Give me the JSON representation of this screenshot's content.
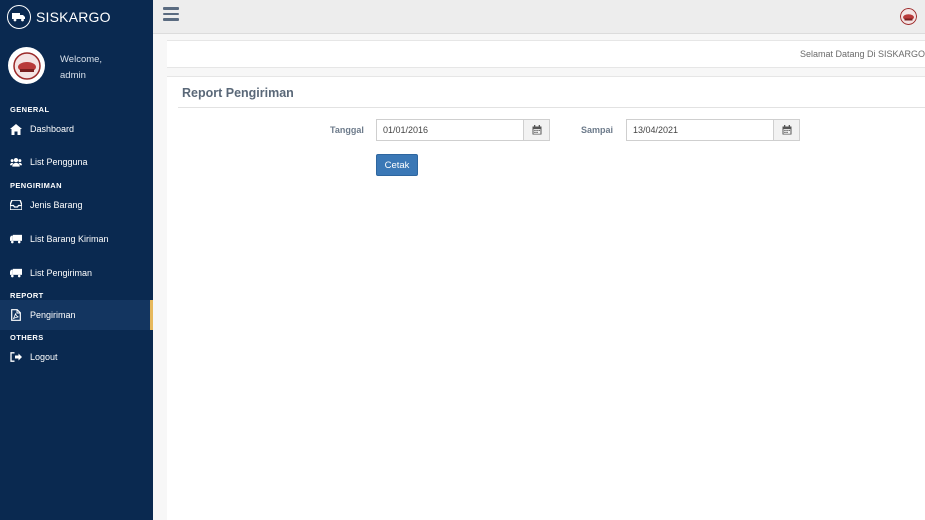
{
  "brand": {
    "name": "SISKARGO"
  },
  "profile": {
    "welcome": "Welcome,",
    "username": "admin"
  },
  "sidebar": {
    "sections": [
      {
        "title": "GENERAL"
      },
      {
        "title": "PENGIRIMAN"
      },
      {
        "title": "REPORT"
      },
      {
        "title": "OTHERS"
      }
    ],
    "items": [
      {
        "label": "Dashboard",
        "icon": "home-icon"
      },
      {
        "label": "List Pengguna",
        "icon": "users-icon"
      },
      {
        "label": "Jenis Barang",
        "icon": "inbox-icon"
      },
      {
        "label": "List Barang Kiriman",
        "icon": "truck-icon"
      },
      {
        "label": "List Pengiriman",
        "icon": "truck-icon"
      },
      {
        "label": "Pengiriman",
        "icon": "pdf-file-icon",
        "active": true
      },
      {
        "label": "Logout",
        "icon": "sign-out-icon"
      }
    ]
  },
  "header": {
    "greeting": "Selamat Datang Di SISKARGO"
  },
  "main": {
    "title": "Report Pengiriman",
    "form": {
      "from_label": "Tanggal",
      "from_value": "01/01/2016",
      "to_label": "Sampai",
      "to_value": "13/04/2021",
      "submit_label": "Cetak"
    }
  },
  "colors": {
    "sidebar_bg": "#0a2950",
    "active_item_bg": "#133560",
    "active_indicator": "#e6b85c",
    "primary_button": "#3b78b6"
  }
}
